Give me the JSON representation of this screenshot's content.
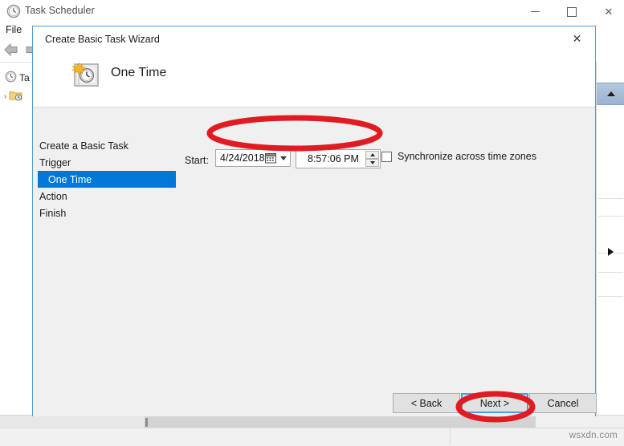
{
  "background_window": {
    "title": "Task Scheduler",
    "title_icon": "clock-icon",
    "window_controls": {
      "minimize": "minimize-icon",
      "maximize": "maximize-icon",
      "close": "close-icon"
    },
    "menu": {
      "file": "File"
    },
    "toolbar": {
      "back_icon": "back-arrow-icon",
      "forward_icon": "forward-arrow-icon"
    },
    "tree": {
      "root_label": "Ta",
      "root_icon": "clock-icon",
      "child_icon": "folder-clock-icon",
      "expander": "›"
    },
    "right_pane": {
      "collapse_icon": "collapse-up-icon",
      "flyout_icon": "flyout-right-arrow-icon"
    }
  },
  "dialog": {
    "titlebar": {
      "title": "Create Basic Task Wizard",
      "close_label": "✕"
    },
    "header": {
      "icon": "one-time-calendar-clock-icon",
      "title": "One Time"
    },
    "steps": [
      {
        "label": "Create a Basic Task",
        "selected": false,
        "sub": false
      },
      {
        "label": "Trigger",
        "selected": false,
        "sub": false
      },
      {
        "label": "One Time",
        "selected": true,
        "sub": true
      },
      {
        "label": "Action",
        "selected": false,
        "sub": false
      },
      {
        "label": "Finish",
        "selected": false,
        "sub": false
      }
    ],
    "fields": {
      "start_label": "Start:",
      "date_value": "4/24/2018",
      "date_icon": "calendar-icon",
      "date_dropdown_icon": "chevron-down-icon",
      "time_value": "8:57:06 PM",
      "time_spin_up_icon": "spinner-up-icon",
      "time_spin_down_icon": "spinner-down-icon",
      "sync_checkbox_checked": false,
      "sync_label": "Synchronize across time zones"
    },
    "buttons": {
      "back": "< Back",
      "next": "Next >",
      "cancel": "Cancel"
    }
  },
  "annotations": {
    "color": "#e01b22",
    "ellipse_fields": "red-ellipse-around-date-time-fields",
    "ellipse_next": "red-ellipse-around-next-button"
  },
  "watermark": "wsxdn.com"
}
